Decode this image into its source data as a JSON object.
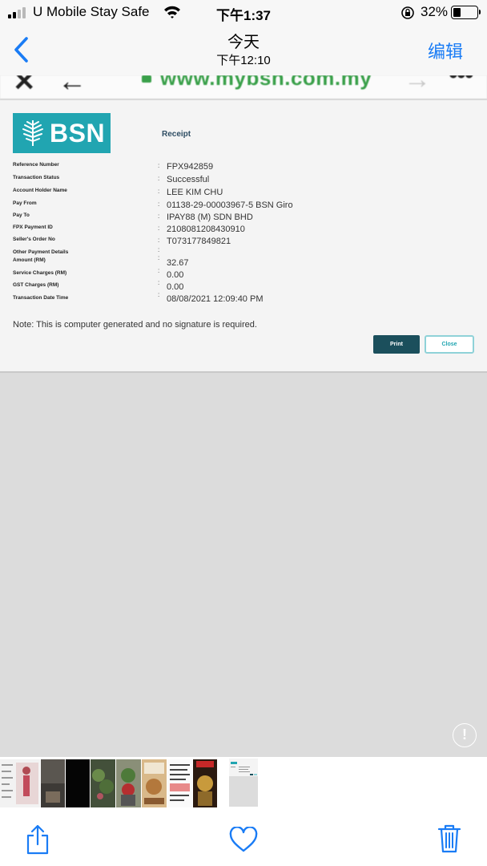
{
  "status_bar": {
    "carrier": "U Mobile Stay Safe",
    "time": "下午1:37",
    "battery_percent": "32%",
    "battery_level": 0.32,
    "signal_bars": 2
  },
  "nav": {
    "title": "今天",
    "subtitle": "下午12:10",
    "edit_label": "编辑",
    "accent_color": "#1a7cf5"
  },
  "browser": {
    "url": "www.mybsn.com.my"
  },
  "receipt": {
    "logo_text": "BSN",
    "title": "Receipt",
    "rows": [
      {
        "label": "Reference Number",
        "value": "FPX942859"
      },
      {
        "label": "Transaction Status",
        "value": "Successful"
      },
      {
        "label": "Account Holder Name",
        "value": "LEE KIM CHU"
      },
      {
        "label": "Pay From",
        "value": "01138-29-00003967-5 BSN Giro"
      },
      {
        "label": "Pay To",
        "value": "IPAY88 (M) SDN BHD"
      },
      {
        "label": "FPX Payment ID",
        "value": "2108081208430910"
      },
      {
        "label": "Seller's Order No",
        "value": "T073177849821"
      },
      {
        "label": "Other Payment Details",
        "value": ""
      },
      {
        "label": "Amount (RM)",
        "value": "32.67"
      },
      {
        "label": "Service Charges (RM)",
        "value": "0.00"
      },
      {
        "label": "GST Charges (RM)",
        "value": "0.00"
      },
      {
        "label": "Transaction Date Time",
        "value": "08/08/2021 12:09:40 PM"
      }
    ],
    "note": "Note: This is computer generated and no signature is required.",
    "print_label": "Print",
    "close_label": "Close",
    "brand_color": "#21a5b1"
  },
  "info_button": "!",
  "toolbar": {
    "share_icon": "share-icon",
    "favorite_icon": "heart-icon",
    "delete_icon": "trash-icon"
  }
}
